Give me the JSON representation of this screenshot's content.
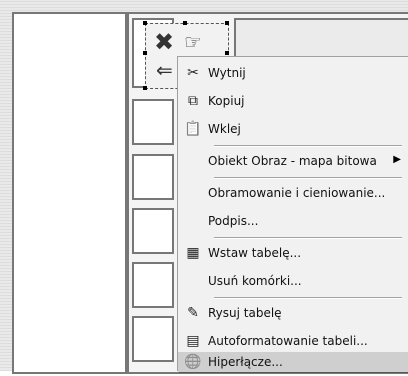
{
  "context_menu": {
    "items": [
      {
        "label": "Wytnij",
        "icon": "scissors-icon"
      },
      {
        "label": "Kopiuj",
        "icon": "copy-icon"
      },
      {
        "label": "Wklej",
        "icon": "clipboard-icon"
      },
      {
        "label": "Obiekt Obraz - mapa bitowa",
        "has_submenu": true
      },
      {
        "label": "Obramowanie i cieniowanie..."
      },
      {
        "label": "Podpis..."
      },
      {
        "label": "Wstaw tabelę...",
        "icon": "table-icon"
      },
      {
        "label": "Usuń komórki..."
      },
      {
        "label": "Rysuj tabelę",
        "icon": "pencil-icon"
      },
      {
        "label": "Autoformatowanie tabeli...",
        "icon": "autoformat-icon"
      },
      {
        "label": "Hiperłącze...",
        "icon": "hyperlink-globe-icon",
        "highlighted": true
      }
    ]
  }
}
